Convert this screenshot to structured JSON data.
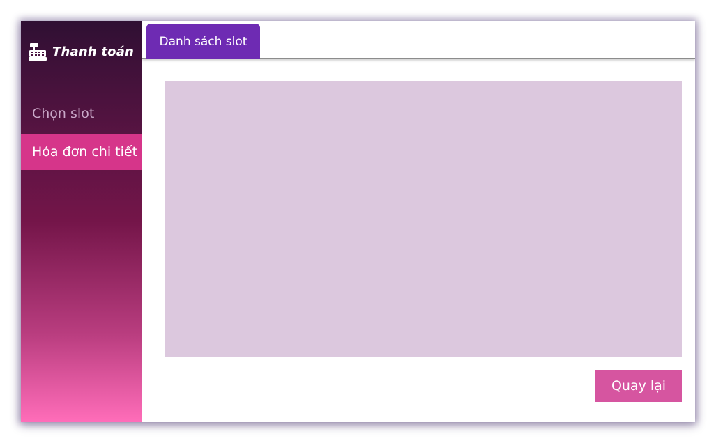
{
  "sidebar": {
    "brand": {
      "icon": "cash-register-icon",
      "title": "Thanh toán"
    },
    "items": [
      {
        "label": "Chọn slot",
        "active": false
      },
      {
        "label": "Hóa đơn chi tiết",
        "active": true
      }
    ]
  },
  "tabs": [
    {
      "label": "Danh sách slot",
      "active": true
    }
  ],
  "footer": {
    "back_label": "Quay lại"
  },
  "colors": {
    "sidebar_gradient_top": "#2f0f33",
    "sidebar_gradient_bottom": "#ff6db9",
    "active_nav": "#d6358a",
    "tab_active": "#6e2bb3",
    "content_panel": "#dcc8de",
    "back_button": "#d655a0"
  }
}
